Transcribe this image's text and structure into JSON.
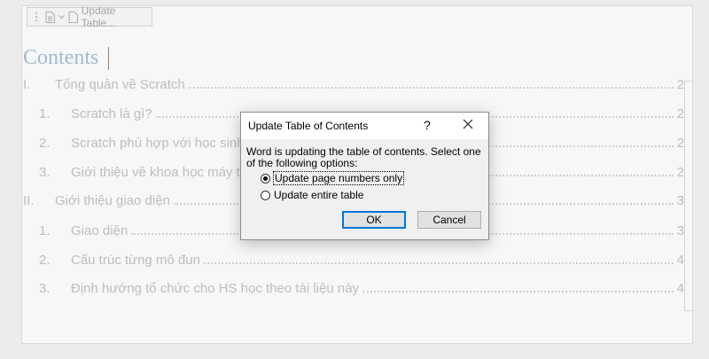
{
  "toolbar": {
    "update_table_label": "Update Table..."
  },
  "document": {
    "toc_title": "Contents",
    "entries": [
      {
        "num": "I.",
        "text": "Tổng quản về Scratch",
        "page": "2",
        "level": 1
      },
      {
        "num": "1.",
        "text": "Scratch là gì?",
        "page": "2",
        "level": 2
      },
      {
        "num": "2.",
        "text": "Scratch phù hợp với học sinh",
        "page": "2",
        "level": 2
      },
      {
        "num": "3.",
        "text": "Giới thiệu về khoa học máy tính",
        "page": "2",
        "level": 2
      },
      {
        "num": "II.",
        "text": "Giới thiệu giao diện",
        "page": "3",
        "level": 1
      },
      {
        "num": "1.",
        "text": "Giao diện",
        "page": "3",
        "level": 2
      },
      {
        "num": "2.",
        "text": "Cấu trúc từng mô đun",
        "page": "4",
        "level": 2
      },
      {
        "num": "3.",
        "text": "Định hướng tổ chức cho HS học theo tài liệu này",
        "page": "4",
        "level": 2
      }
    ]
  },
  "dialog": {
    "title": "Update Table of Contents",
    "help_label": "?",
    "message_line1": "Word is updating the table of contents.  Select one",
    "message_line2": "of the following options:",
    "option_page_numbers": "Update page numbers only",
    "option_entire_table": "Update entire table",
    "selected_option": "page_numbers",
    "ok_label": "OK",
    "cancel_label": "Cancel"
  }
}
